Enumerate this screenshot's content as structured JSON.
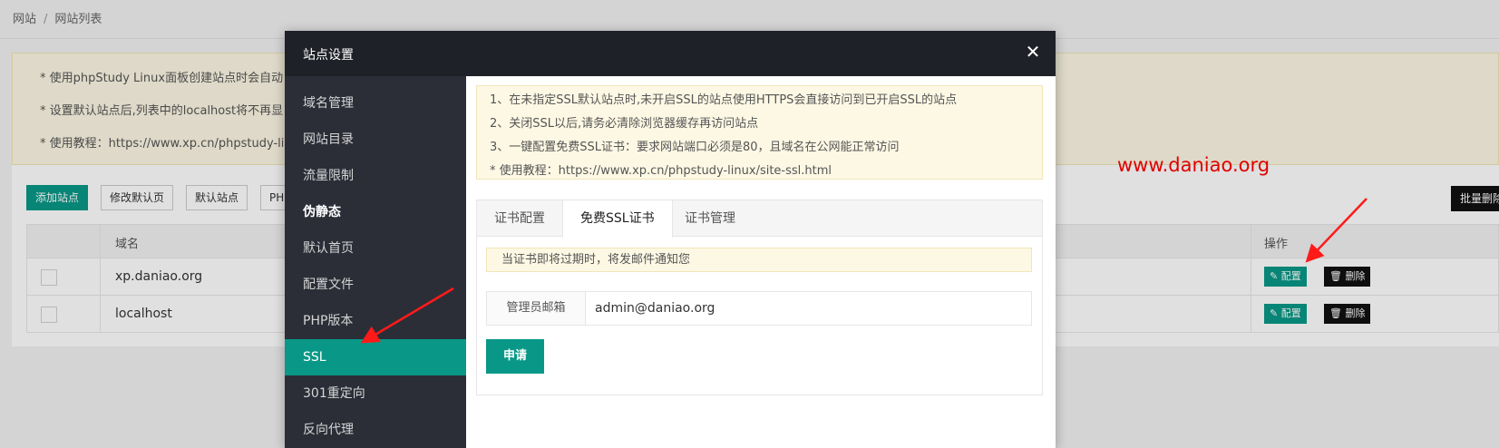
{
  "breadcrumb": {
    "root": "网站",
    "separator": "/",
    "current": "网站列表"
  },
  "page_notice": [
    "* 使用phpStudy Linux面板创建站点时会自动",
    "* 设置默认站点后,列表中的localhost将不再显",
    "* 使用教程：https://www.xp.cn/phpstudy-lin"
  ],
  "toolbar": {
    "add_site": "添加站点",
    "edit_default_page": "修改默认页",
    "default_site": "默认站点",
    "php": "PH",
    "bulk_delete": "批量删除"
  },
  "table": {
    "headers": {
      "domain": "域名",
      "actions": "操作"
    },
    "rows": [
      {
        "domain": "xp.daniao.org"
      },
      {
        "domain": "localhost"
      }
    ],
    "actions": {
      "config": "配置",
      "delete": "删除"
    }
  },
  "watermark": "www.daniao.org",
  "modal": {
    "title": "站点设置",
    "close_icon": "close-icon",
    "sidebar": [
      {
        "label": "域名管理",
        "bold": false,
        "active": false
      },
      {
        "label": "网站目录",
        "bold": false,
        "active": false
      },
      {
        "label": "流量限制",
        "bold": false,
        "active": false
      },
      {
        "label": "伪静态",
        "bold": true,
        "active": false
      },
      {
        "label": "默认首页",
        "bold": false,
        "active": false
      },
      {
        "label": "配置文件",
        "bold": false,
        "active": false
      },
      {
        "label": "PHP版本",
        "bold": false,
        "active": false
      },
      {
        "label": "SSL",
        "bold": false,
        "active": true
      },
      {
        "label": "301重定向",
        "bold": false,
        "active": false
      },
      {
        "label": "反向代理",
        "bold": false,
        "active": false
      }
    ],
    "tips": [
      "1、在未指定SSL默认站点时,未开启SSL的站点使用HTTPS会直接访问到已开启SSL的站点",
      "2、关闭SSL以后,请务必清除浏览器缓存再访问站点",
      "3、一键配置免费SSL证书：要求网站端口必须是80，且域名在公网能正常访问",
      "* 使用教程：https://www.xp.cn/phpstudy-linux/site-ssl.html"
    ],
    "tabs": [
      "证书配置",
      "免费SSL证书",
      "证书管理"
    ],
    "active_tab": 1,
    "tab_notice": "当证书即将过期时，将发邮件通知您",
    "form": {
      "label": "管理员邮箱",
      "value": "admin@daniao.org"
    },
    "apply_button": "申请"
  },
  "colors": {
    "accent": "#099887",
    "header_dark": "#1f2128",
    "sidebar_dark": "#2b2e37",
    "arrow_red": "#ff1a1a"
  }
}
